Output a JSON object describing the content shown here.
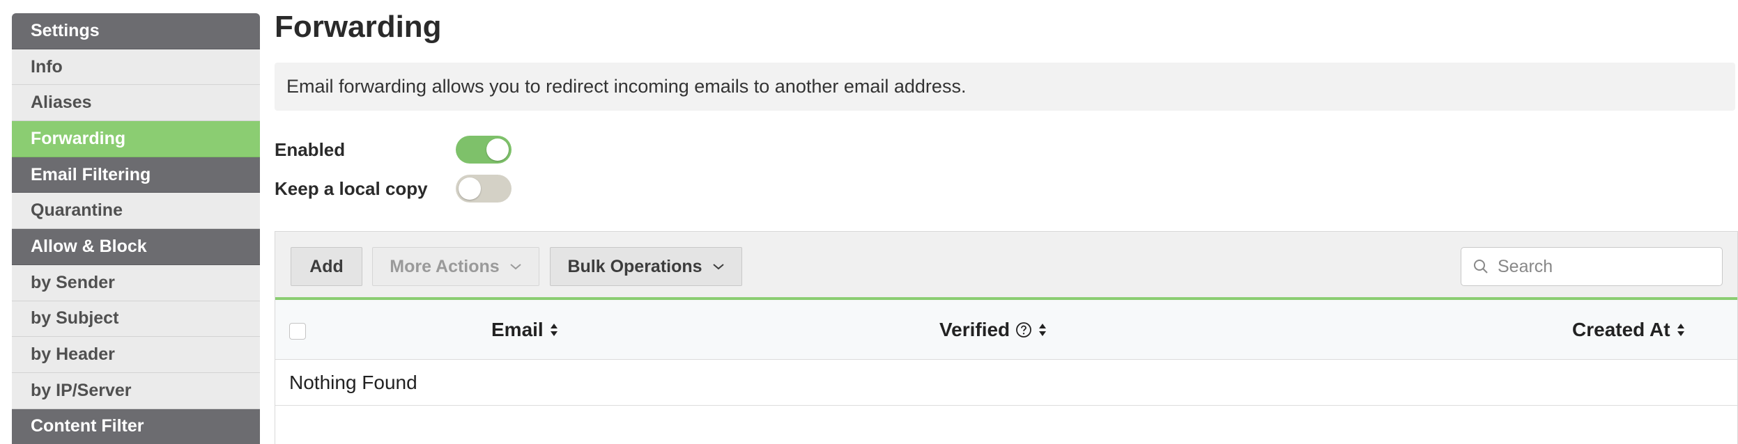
{
  "sidebar": {
    "items": [
      {
        "label": "Settings",
        "kind": "header"
      },
      {
        "label": "Info",
        "kind": "item"
      },
      {
        "label": "Aliases",
        "kind": "item"
      },
      {
        "label": "Forwarding",
        "kind": "active"
      },
      {
        "label": "Email Filtering",
        "kind": "header"
      },
      {
        "label": "Quarantine",
        "kind": "item"
      },
      {
        "label": "Allow & Block",
        "kind": "header"
      },
      {
        "label": "by Sender",
        "kind": "item"
      },
      {
        "label": "by Subject",
        "kind": "item"
      },
      {
        "label": "by Header",
        "kind": "item"
      },
      {
        "label": "by IP/Server",
        "kind": "item"
      },
      {
        "label": "Content Filter",
        "kind": "header"
      }
    ]
  },
  "page": {
    "title": "Forwarding",
    "description": "Email forwarding allows you to redirect incoming emails to another email address."
  },
  "toggles": {
    "enabled": {
      "label": "Enabled",
      "on": true
    },
    "local_copy": {
      "label": "Keep a local copy",
      "on": false
    }
  },
  "toolbar": {
    "add_label": "Add",
    "more_actions_label": "More Actions",
    "bulk_operations_label": "Bulk Operations",
    "search_placeholder": "Search"
  },
  "table": {
    "columns": {
      "email": "Email",
      "verified": "Verified",
      "created_at": "Created At"
    },
    "empty_text": "Nothing Found"
  },
  "colors": {
    "accent_green": "#8bcd72",
    "sidebar_header": "#6c6c70",
    "sidebar_item": "#ebebeb"
  },
  "icons": {
    "search": "search-icon",
    "chevron": "chevron-down-icon",
    "sort": "sort-icon",
    "help": "help-circle-icon"
  }
}
